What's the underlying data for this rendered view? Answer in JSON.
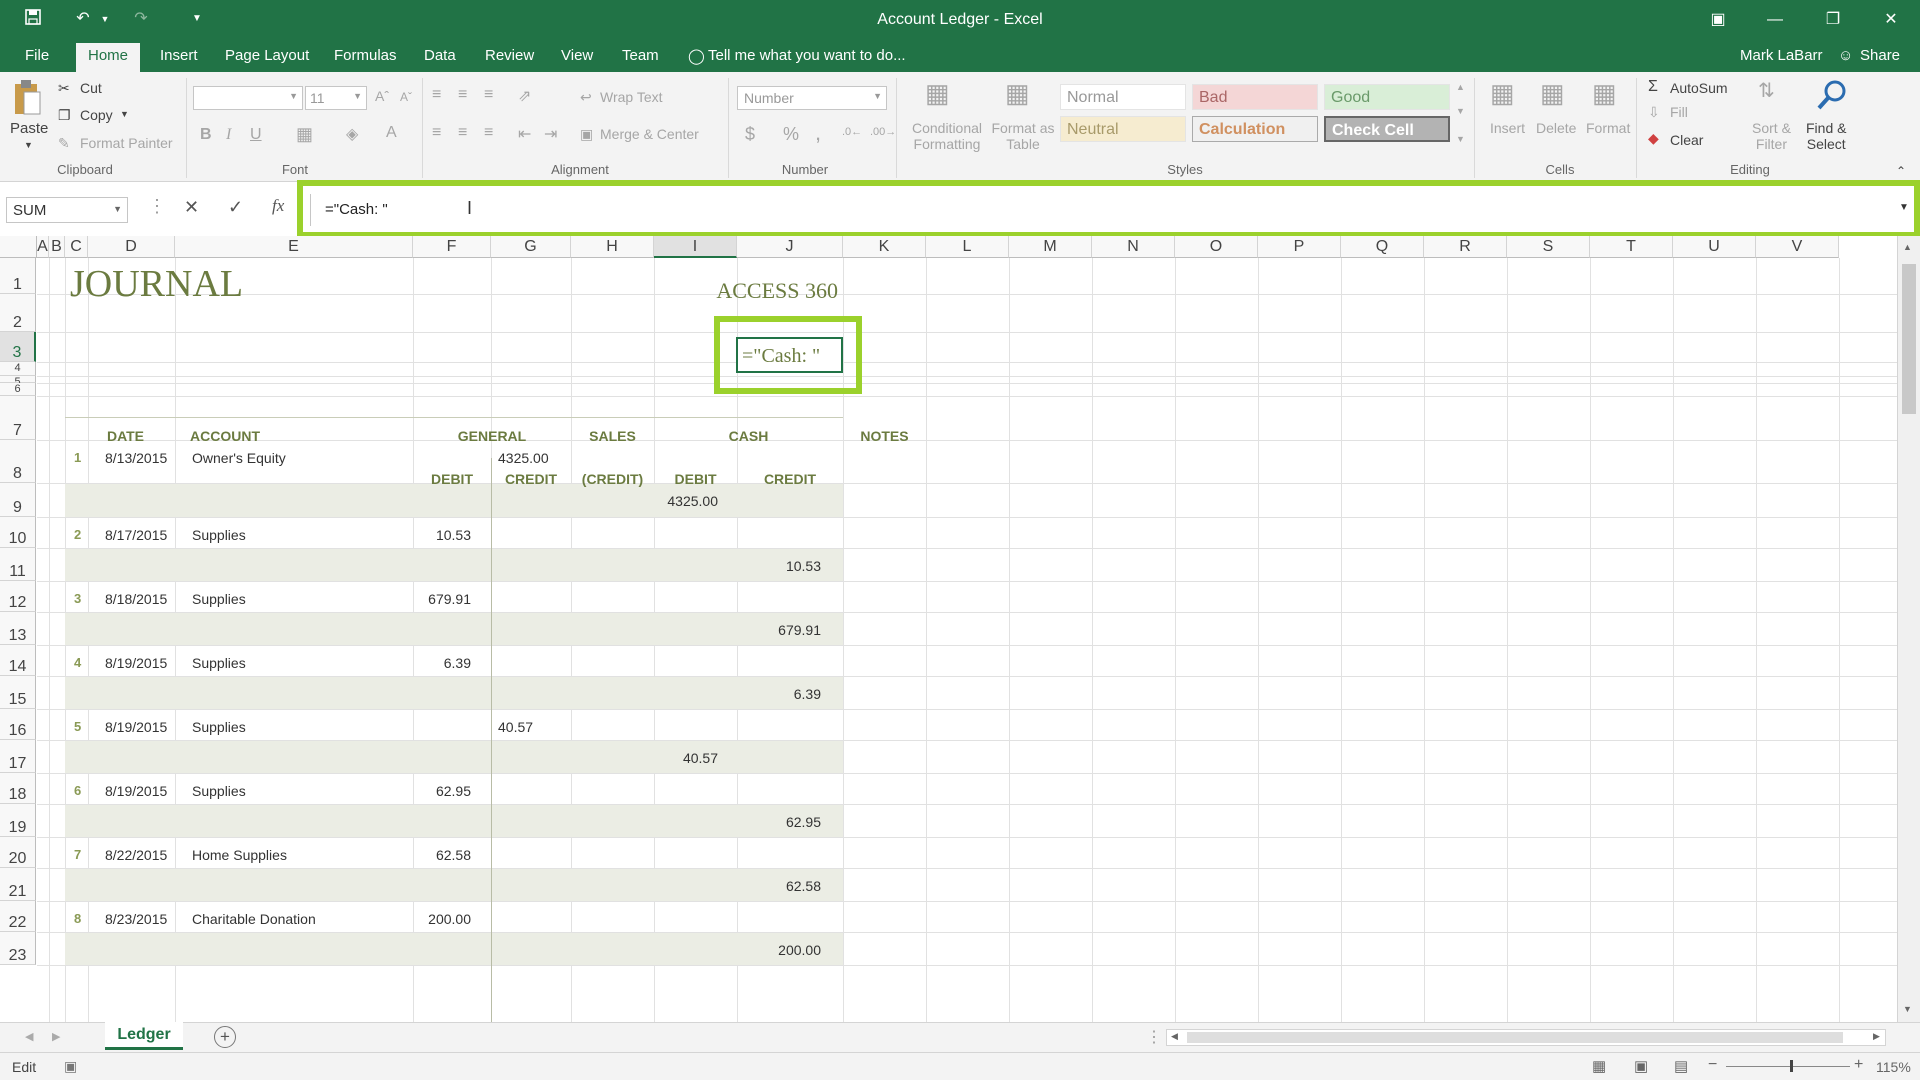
{
  "window": {
    "title": "Account Ledger - Excel",
    "user": "Mark LaBarr",
    "share": "Share"
  },
  "tabs": [
    "File",
    "Home",
    "Insert",
    "Page Layout",
    "Formulas",
    "Data",
    "Review",
    "View",
    "Team"
  ],
  "tell_me": "Tell me what you want to do...",
  "clipboard": {
    "paste": "Paste",
    "cut": "Cut",
    "copy": "Copy",
    "format_painter": "Format Painter",
    "group": "Clipboard"
  },
  "font": {
    "size": "11",
    "bold": "B",
    "italic": "I",
    "underline": "U",
    "group": "Font"
  },
  "alignment": {
    "wrap": "Wrap Text",
    "merge": "Merge & Center",
    "group": "Alignment"
  },
  "number": {
    "format": "Number",
    "currency": "$",
    "percent": "%",
    "comma": ",",
    "group": "Number"
  },
  "styles": {
    "conditional": "Conditional",
    "formatting": "Formatting",
    "format_as": "Format as",
    "table": "Table",
    "normal": "Normal",
    "bad": "Bad",
    "good": "Good",
    "neutral": "Neutral",
    "calculation": "Calculation",
    "check_cell": "Check Cell",
    "group": "Styles"
  },
  "cells": {
    "insert": "Insert",
    "delete": "Delete",
    "format": "Format",
    "group": "Cells"
  },
  "editing": {
    "autosum": "AutoSum",
    "fill": "Fill",
    "clear": "Clear",
    "sort": "Sort &",
    "filter": "Filter",
    "find": "Find &",
    "select": "Select",
    "group": "Editing"
  },
  "formula_bar": {
    "name_box": "SUM",
    "fx": "fx",
    "formula": "=\"Cash: \""
  },
  "columns": [
    "A",
    "B",
    "C",
    "D",
    "E",
    "F",
    "G",
    "H",
    "I",
    "J",
    "K",
    "L",
    "M",
    "N",
    "O",
    "P",
    "Q",
    "R",
    "S",
    "T",
    "U",
    "V"
  ],
  "rows": [
    "1",
    "2",
    "3",
    "4",
    "5",
    "6",
    "7",
    "8",
    "9",
    "10",
    "11",
    "12",
    "13",
    "14",
    "15",
    "16",
    "17",
    "18",
    "19",
    "20",
    "21",
    "22",
    "23"
  ],
  "sheet": {
    "journal_title": "JOURNAL",
    "company": "ACCESS 360",
    "editing_cell": "=\"Cash: \"",
    "headers": {
      "date": "DATE",
      "account": "ACCOUNT",
      "general": "GENERAL",
      "sales": "SALES",
      "cash": "CASH",
      "notes": "NOTES",
      "debit": "DEBIT",
      "credit": "CREDIT",
      "sales_credit": "(CREDIT)",
      "cash_debit": "DEBIT",
      "cash_credit": "CREDIT"
    },
    "entries": [
      {
        "n": "1",
        "date": "8/13/2015",
        "account": "Owner's Equity",
        "gen_debit": "",
        "gen_credit": "4325.00",
        "cash_debit": "4325.00",
        "cash_credit": ""
      },
      {
        "n": "2",
        "date": "8/17/2015",
        "account": "Supplies",
        "gen_debit": "10.53",
        "gen_credit": "",
        "cash_debit": "",
        "cash_credit": "10.53"
      },
      {
        "n": "3",
        "date": "8/18/2015",
        "account": "Supplies",
        "gen_debit": "679.91",
        "gen_credit": "",
        "cash_debit": "",
        "cash_credit": "679.91"
      },
      {
        "n": "4",
        "date": "8/19/2015",
        "account": "Supplies",
        "gen_debit": "6.39",
        "gen_credit": "",
        "cash_debit": "",
        "cash_credit": "6.39"
      },
      {
        "n": "5",
        "date": "8/19/2015",
        "account": "Supplies",
        "gen_debit": "",
        "gen_credit": "40.57",
        "cash_debit": "40.57",
        "cash_credit": ""
      },
      {
        "n": "6",
        "date": "8/19/2015",
        "account": "Supplies",
        "gen_debit": "62.95",
        "gen_credit": "",
        "cash_debit": "",
        "cash_credit": "62.95"
      },
      {
        "n": "7",
        "date": "8/22/2015",
        "account": "Home Supplies",
        "gen_debit": "62.58",
        "gen_credit": "",
        "cash_debit": "",
        "cash_credit": "62.58"
      },
      {
        "n": "8",
        "date": "8/23/2015",
        "account": "Charitable Donation",
        "gen_debit": "200.00",
        "gen_credit": "",
        "cash_debit": "",
        "cash_credit": "200.00"
      }
    ]
  },
  "sheet_tab": "Ledger",
  "status": {
    "mode": "Edit",
    "zoom": "115%"
  },
  "colors": {
    "excel_green": "#217346",
    "highlight": "#9bd12c",
    "band": "#ebede4",
    "title_green": "#6b7b40"
  }
}
